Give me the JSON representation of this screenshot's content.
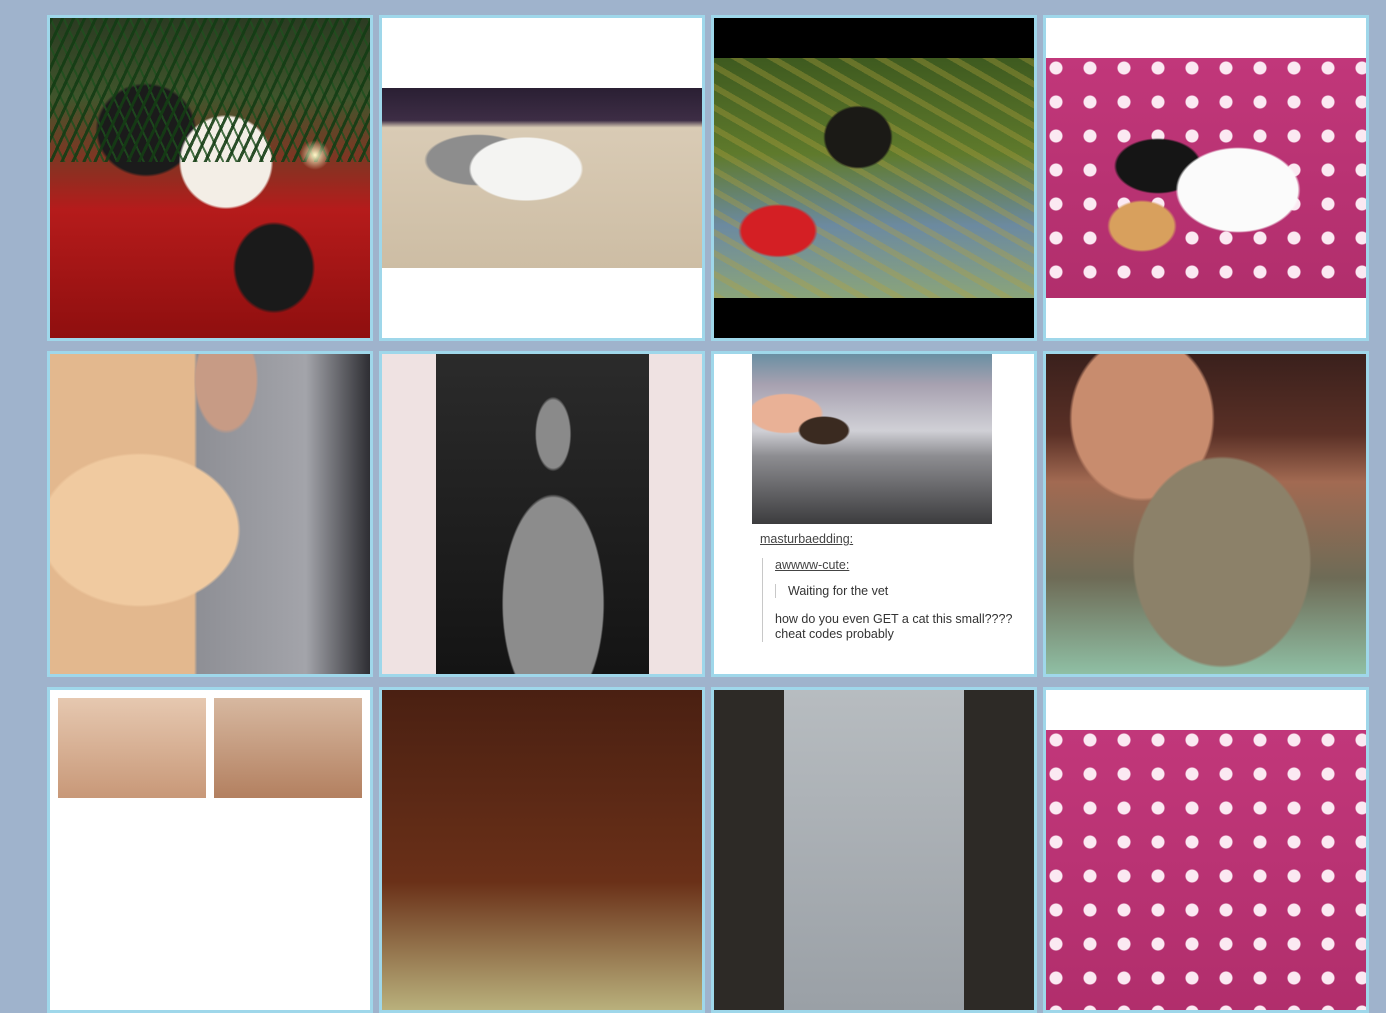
{
  "colors": {
    "page_background": "#9fb3cc",
    "tile_border": "#9fd7ea"
  },
  "posts": [
    {
      "kind": "photo"
    },
    {
      "kind": "photo"
    },
    {
      "kind": "photo"
    },
    {
      "kind": "photo"
    },
    {
      "kind": "photo"
    },
    {
      "kind": "photo"
    },
    {
      "kind": "text_post",
      "user": "masturbaedding:",
      "quoted_user": "awwww-cute:",
      "quoted_text": "Waiting for the vet",
      "reply": "how do you even GET a cat this small???? cheat codes probably"
    },
    {
      "kind": "photo"
    },
    {
      "kind": "photo"
    },
    {
      "kind": "photo"
    },
    {
      "kind": "photo"
    },
    {
      "kind": "photo"
    }
  ]
}
